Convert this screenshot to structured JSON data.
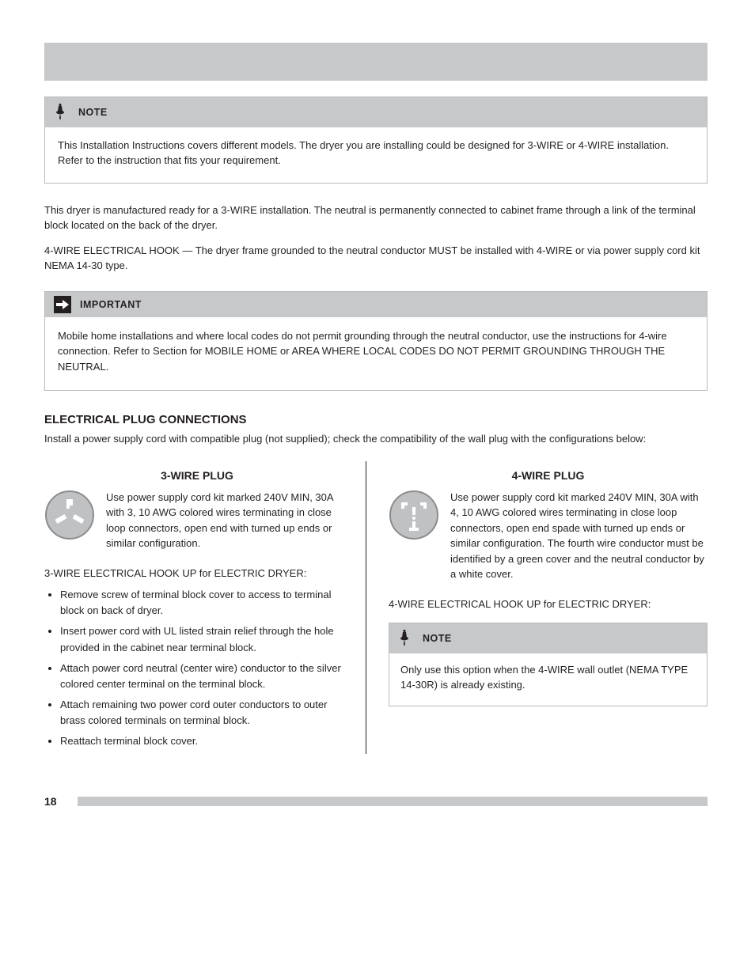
{
  "note1": {
    "head": "NOTE",
    "body": "This Installation Instructions covers different models. The dryer you are installing could be designed for 3-WIRE or 4-WIRE installation. Refer to the instruction that fits your requirement."
  },
  "para1": "This dryer is manufactured ready for a 3-WIRE installation. The neutral is permanently connected to cabinet frame through a link of the terminal block located on the back of the dryer.",
  "para2": "4-WIRE ELECTRICAL HOOK — The dryer frame grounded to the neutral conductor MUST be installed with 4-WIRE or via power supply cord kit NEMA 14-30 type.",
  "important": {
    "head": "IMPORTANT",
    "body": "Mobile home installations and where local codes do not permit grounding through the neutral conductor, use the instructions for 4-wire connection. Refer to Section for MOBILE HOME or AREA WHERE LOCAL CODES DO NOT PERMIT GROUNDING THROUGH THE NEUTRAL."
  },
  "section_h": "ELECTRICAL PLUG CONNECTIONS",
  "section_p": "Install a power supply cord with compatible plug (not supplied); check the compatibility of the wall plug with the configurations below:",
  "col_left": {
    "h": "3-WIRE PLUG",
    "desc": "Use power supply cord kit marked 240V MIN, 30A with 3, 10 AWG colored wires terminating in close loop connectors, open end with turned up ends or similar configuration.",
    "lead": "3-WIRE ELECTRICAL HOOK UP for ELECTRIC DRYER:",
    "bullets": [
      "Remove screw of terminal block cover to access to terminal block on back of dryer.",
      "Insert power cord with UL listed strain relief through the hole provided in the cabinet near terminal block.",
      "Attach power cord neutral (center wire) conductor to the silver colored center terminal on the terminal block.",
      "Attach remaining two power cord outer conductors to outer brass colored terminals on terminal block.",
      "Reattach terminal block cover."
    ]
  },
  "col_right": {
    "h": "4-WIRE PLUG",
    "desc": "Use power supply cord kit marked 240V MIN, 30A with 4, 10 AWG colored wires terminating in close loop connectors, open end spade with turned up ends or similar configuration. The fourth wire conductor must be identified by a green cover and the neutral conductor by a white cover.",
    "lead": "4-WIRE ELECTRICAL HOOK UP for ELECTRIC DRYER:",
    "note_head": "NOTE",
    "note_body": "Only use this option when the 4-WIRE  wall outlet (NEMA TYPE 14-30R) is already existing."
  },
  "page_num": "18"
}
